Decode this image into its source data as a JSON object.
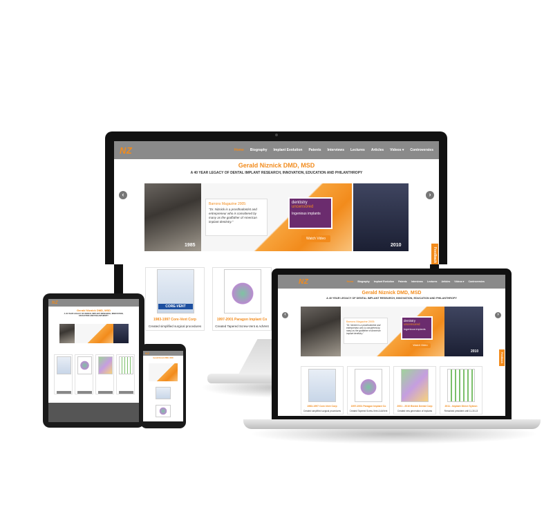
{
  "site": {
    "logo": "NZ",
    "title": "Gerald Niznick DMD, MSD",
    "subtitle": "A 40 YEAR LEGACY OF DENTAL IMPLANT RESEARCH, INNOVATION, EDUCATION AND PHILANTHROPY",
    "menu": [
      "Home",
      "Biography",
      "Implant Evolution",
      "Patents",
      "Interviews",
      "Lectures",
      "Articles",
      "Videos ▾",
      "Controversies"
    ],
    "hero": {
      "quote_title": "Barrons Magazine 2005:",
      "quote_text": "\"Dr. Niznick is a prosthodontist and entrepreneur who is considered by many as the godfather of American implant dentistry.\"",
      "video_line1": "dentistry",
      "video_line2": "uncensored",
      "video_line3": "Ingenious implants",
      "video_button": "Watch Video",
      "year_left": "1985",
      "year_right": "2010",
      "prev_arrow": "‹",
      "next_arrow": "›"
    },
    "cards": [
      {
        "title": "1983-1997 Core-Vent Corp",
        "text": "Created simplified surgical procedures",
        "img_label": "CORE-VENT"
      },
      {
        "title": "1997-2001 Paragon Implant Co",
        "text": "Created Tapered Screw-Vent & AdVent",
        "img_label": ""
      },
      {
        "title": "2001 - 2010 Biolok Dental Corp",
        "text": "Created new generation of implants",
        "img_label": ""
      },
      {
        "title": "2011 - Implant Direct Sybron",
        "text": "Remained president until 11-30-13",
        "img_label": ""
      }
    ],
    "feedback": "Feedback"
  },
  "colors": {
    "accent": "#f28b1c",
    "nav_bg": "#8a8a8a",
    "frame": "#111111"
  }
}
